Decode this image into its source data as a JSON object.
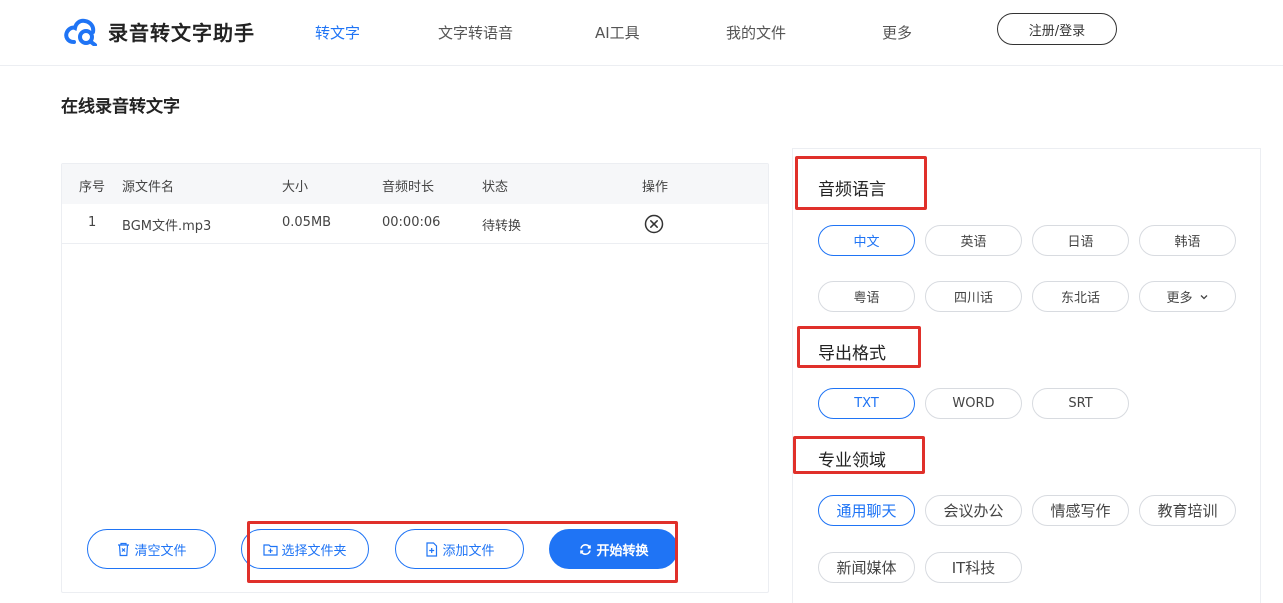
{
  "brand": {
    "name": "录音转文字助手",
    "accent": "#1f74f5",
    "annotation_color": "#e0302a"
  },
  "nav": {
    "items": [
      "转文字",
      "文字转语音",
      "AI工具",
      "我的文件",
      "更多"
    ],
    "active": "转文字",
    "login": "注册/登录"
  },
  "page": {
    "title": "在线录音转文字"
  },
  "file_table": {
    "headers": [
      "序号",
      "源文件名",
      "大小",
      "音频时长",
      "状态",
      "操作"
    ],
    "rows": [
      {
        "index": "1",
        "name": "BGM文件.mp3",
        "size": "0.05MB",
        "duration": "00:00:06",
        "status": "待转换",
        "action_icon": "close-circle-icon"
      }
    ]
  },
  "actions": {
    "clear": "清空文件",
    "select_folder": "选择文件夹",
    "add_file": "添加文件",
    "start": "开始转换"
  },
  "options": {
    "language": {
      "title": "音频语言",
      "items": [
        "中文",
        "英语",
        "日语",
        "韩语",
        "粤语",
        "四川话",
        "东北话",
        "更多"
      ],
      "selected": "中文"
    },
    "format": {
      "title": "导出格式",
      "items": [
        "TXT",
        "WORD",
        "SRT"
      ],
      "selected": "TXT"
    },
    "domain": {
      "title": "专业领域",
      "items": [
        "通用聊天",
        "会议办公",
        "情感写作",
        "教育培训",
        "新闻媒体",
        "IT科技"
      ],
      "selected": "通用聊天"
    }
  }
}
